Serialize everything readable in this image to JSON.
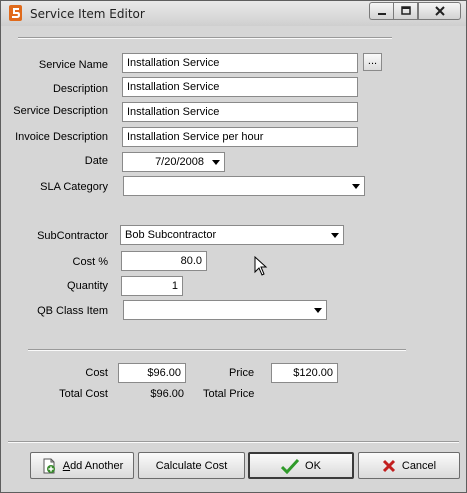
{
  "window": {
    "title": "Service Item Editor"
  },
  "fields": {
    "service_name": {
      "label": "Service Name",
      "value": "Installation Service"
    },
    "description": {
      "label": "Description",
      "value": "Installation Service"
    },
    "service_description": {
      "label": "Service Description",
      "value": "Installation Service"
    },
    "invoice_description": {
      "label": "Invoice Description",
      "value": "Installation Service per hour"
    },
    "date": {
      "label": "Date",
      "value": "7/20/2008"
    },
    "sla_category": {
      "label": "SLA Category",
      "value": ""
    },
    "subcontractor": {
      "label": "SubContractor",
      "value": "Bob Subcontractor"
    },
    "cost_percent": {
      "label": "Cost  %",
      "value": "80.0"
    },
    "quantity": {
      "label": "Quantity",
      "value": "1"
    },
    "qb_class_item": {
      "label": "QB Class Item",
      "value": ""
    }
  },
  "ellipsis_label": "...",
  "totals": {
    "cost_label": "Cost",
    "cost_value": "$96.00",
    "price_label": "Price",
    "price_value": "$120.00",
    "total_cost_label": "Total Cost",
    "total_cost_value": "$96.00",
    "total_price_label": "Total Price"
  },
  "buttons": {
    "add_another": "Add Another",
    "calculate_cost": "Calculate Cost",
    "ok": "OK",
    "cancel": "Cancel"
  },
  "icons": {
    "app": "app-icon",
    "add": "add-document-icon",
    "ok": "checkmark-icon",
    "cancel": "x-icon",
    "cursor": "mouse-pointer-icon"
  },
  "colors": {
    "ok_check": "#2f9a2a",
    "cancel_x": "#c21f1f",
    "app_icon": "#e06a1b"
  }
}
